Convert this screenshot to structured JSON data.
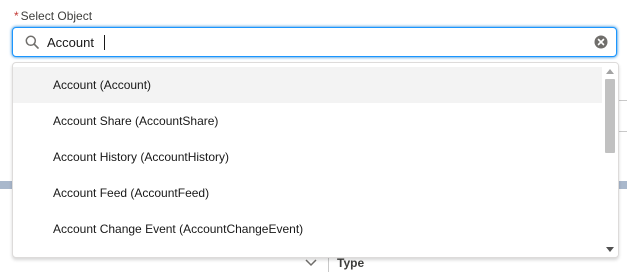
{
  "field": {
    "required_marker": "*",
    "label": "Select Object"
  },
  "search": {
    "value": "Account",
    "placeholder": "",
    "search_icon": "search-icon",
    "clear_icon": "clear-icon"
  },
  "dropdown": {
    "options": [
      {
        "label": "Account (Account)",
        "highlighted": true
      },
      {
        "label": "Account Share (AccountShare)",
        "highlighted": false
      },
      {
        "label": "Account History (AccountHistory)",
        "highlighted": false
      },
      {
        "label": "Account Feed (AccountFeed)",
        "highlighted": false
      },
      {
        "label": "Account Change Event (AccountChangeEvent)",
        "highlighted": false
      }
    ]
  },
  "background": {
    "column_header": "Type",
    "column_icon": "chevron-down-icon"
  },
  "colors": {
    "focus_border": "#1b96ff",
    "required": "#c23934",
    "highlight_row": "#f3f3f3",
    "scroll_thumb": "#c1c1c1"
  }
}
